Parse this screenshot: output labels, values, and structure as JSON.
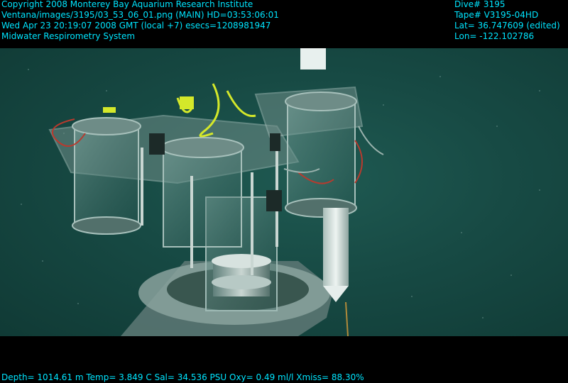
{
  "overlay": {
    "top_left": [
      "Copyright 2008 Monterey Bay Aquarium Research Institute",
      "Ventana/images/3195/03_53_06_01.png (MAIN)  HD=03:53:06:01",
      "Wed Apr 23 20:19:07 2008 GMT (local +7)  esecs=1208981947",
      "Midwater Respirometry System"
    ],
    "top_right": [
      "Dive# 3195",
      "Tape# V3195-04HD",
      "Lat= 36.747609 (edited)",
      "Lon= -122.102786"
    ],
    "bottom": "Depth= 1014.61 m  Temp= 3.849 C  Sal= 34.536 PSU  Oxy= 0.49 ml/l  Xmiss= 88.30%"
  },
  "colors": {
    "overlay_text": "#00e5ff",
    "water": "#174a44",
    "letterbox": "#000000"
  }
}
